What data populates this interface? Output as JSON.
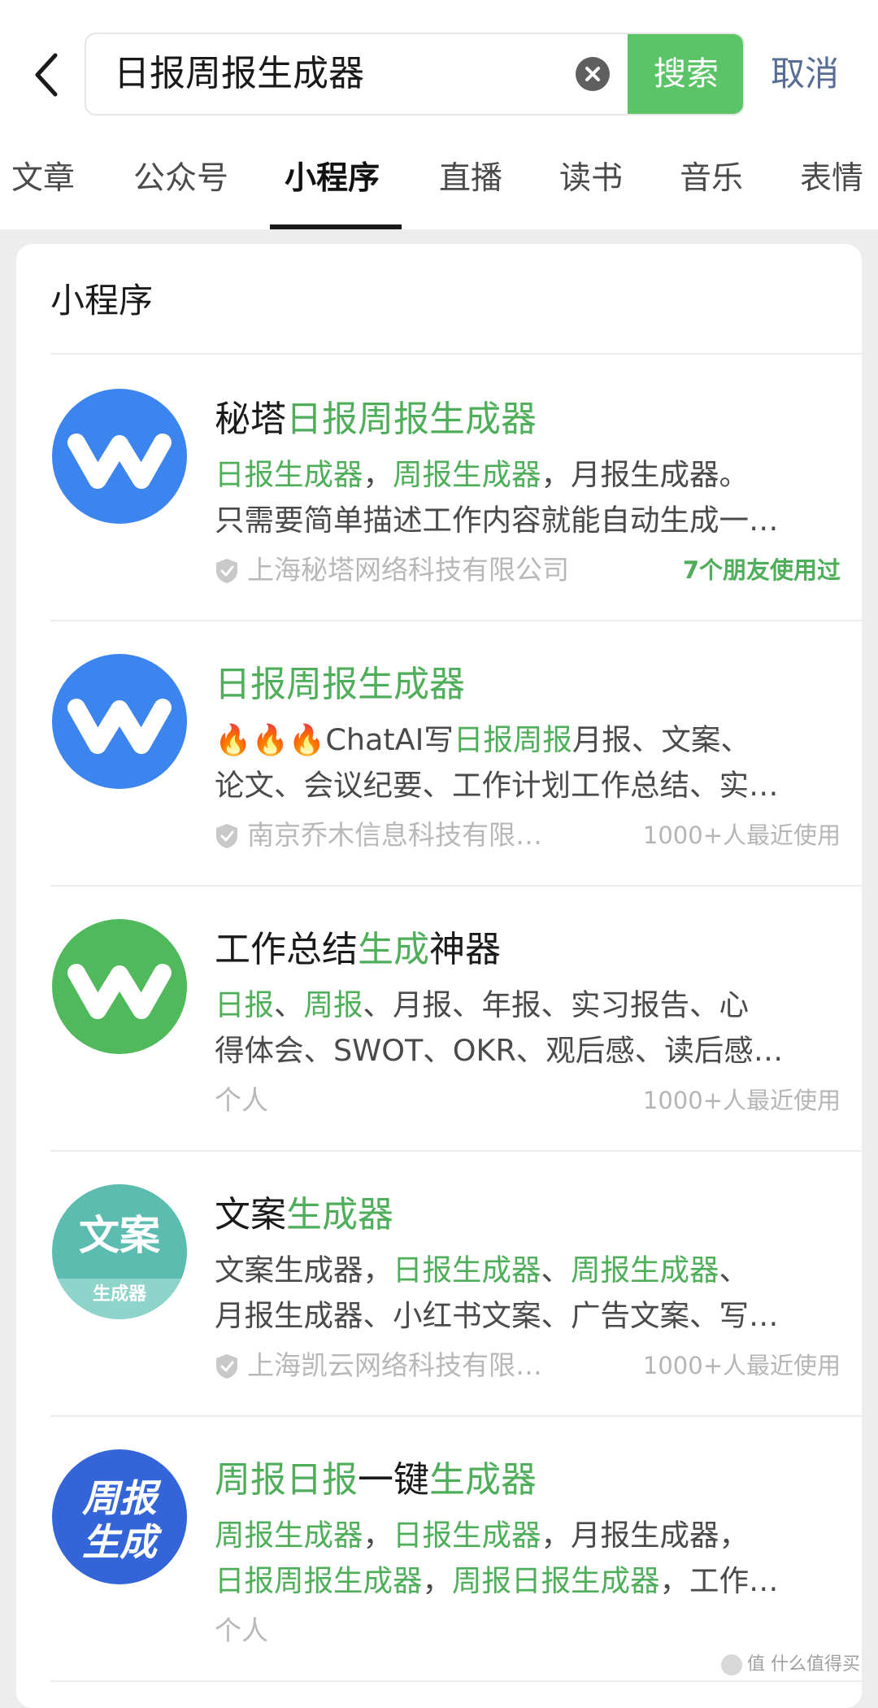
{
  "search": {
    "query": "日报周报生成器",
    "button_label": "搜索",
    "cancel_label": "取消"
  },
  "tabs": [
    {
      "label": "文章"
    },
    {
      "label": "公众号"
    },
    {
      "label": "小程序"
    },
    {
      "label": "直播"
    },
    {
      "label": "读书"
    },
    {
      "label": "音乐"
    },
    {
      "label": "表情"
    }
  ],
  "active_tab": "小程序",
  "section": {
    "title": "小程序"
  },
  "colors": {
    "highlight": "#4fae5a",
    "search_button": "#5bc466",
    "link_blue": "#586c94"
  },
  "results": [
    {
      "title_plain": "秘塔",
      "title_hl": "日报周报生成器",
      "desc_line1_a": "日报生成器",
      "desc_line1_b": "，",
      "desc_line1_c": "周报生成器",
      "desc_line1_d": "，月报生成器。",
      "desc_line2": "只需要简单描述工作内容就能自动生成一…",
      "org": "上海秘塔网络科技有限公司",
      "usage": "7个朋友使用过",
      "icon": "w-logo-blue"
    },
    {
      "title_hl": "日报周报生成器",
      "fire": "🔥🔥🔥",
      "desc_line1_a": "ChatAI写",
      "desc_line1_b": "日报周报",
      "desc_line1_c": "月报、文案、",
      "desc_line2": "论文、会议纪要、工作计划工作总结、实…",
      "org": "南京乔木信息科技有限…",
      "usage": "1000+人最近使用",
      "icon": "w-logo-blue"
    },
    {
      "title_a": "工作总结",
      "title_hl": "生成",
      "title_b": "神器",
      "desc_line1_a": "日报",
      "desc_line1_b": "、",
      "desc_line1_c": "周报",
      "desc_line1_d": "、月报、年报、实习报告、心",
      "desc_line2": "得体会、SWOT、OKR、观后感、读后感…",
      "org": "个人",
      "usage": "1000+人最近使用",
      "icon": "w-logo-green"
    },
    {
      "title_a": "文案",
      "title_hl": "生成器",
      "desc_line1_a": "文案生成器，",
      "desc_line1_b": "日报生成器",
      "desc_line1_c": "、",
      "desc_line1_d": "周报生成器",
      "desc_line1_e": "、",
      "desc_line2": "月报生成器、小红书文案、广告文案、写…",
      "org": "上海凯云网络科技有限…",
      "usage": "1000+人最近使用",
      "icon_text_top": "文案",
      "icon_text_bottom": "生成器"
    },
    {
      "title_hl_a": "周报日报",
      "title_b": "一键",
      "title_hl_c": "生成器",
      "desc_line1_a": "周报生成器",
      "desc_line1_b": "，",
      "desc_line1_c": "日报生成器",
      "desc_line1_d": "，月报生成器，",
      "desc_line2_a": "日报周报生成器",
      "desc_line2_b": "，",
      "desc_line2_c": "周报日报生成器",
      "desc_line2_d": "，工作…",
      "org": "个人",
      "icon_text_top": "周报",
      "icon_text_bottom": "生成"
    }
  ],
  "watermark": "值 什么值得买"
}
